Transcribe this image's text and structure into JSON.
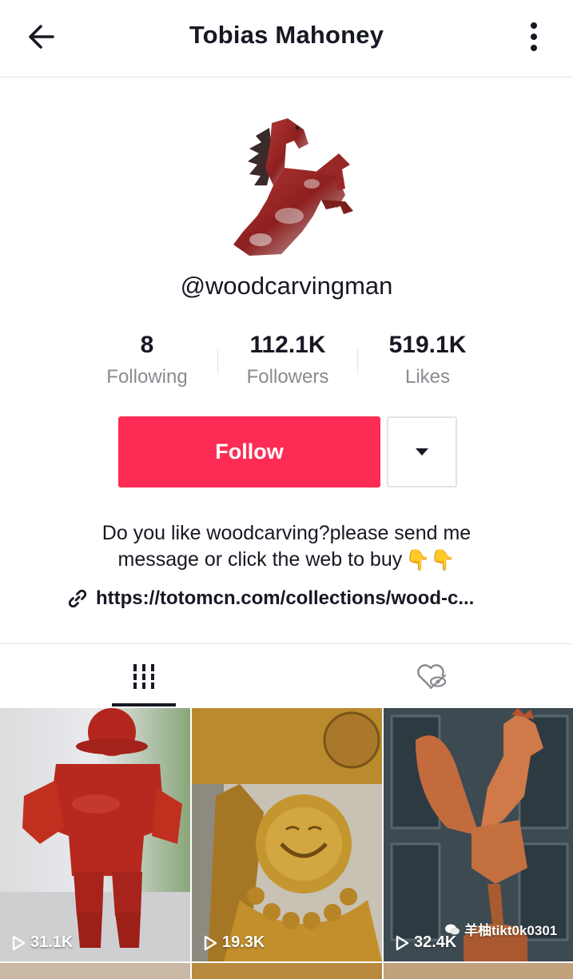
{
  "header": {
    "title": "Tobias Mahoney",
    "back_icon": "arrow-left-icon",
    "more_icon": "more-vertical-icon"
  },
  "profile": {
    "username": "@woodcarvingman",
    "avatar_icon": "carved-horse-avatar"
  },
  "stats": [
    {
      "value": "8",
      "label": "Following"
    },
    {
      "value": "112.1K",
      "label": "Followers"
    },
    {
      "value": "519.1K",
      "label": "Likes"
    }
  ],
  "actions": {
    "follow_label": "Follow",
    "dropdown_icon": "caret-down-icon"
  },
  "bio": {
    "line1": "Do you like woodcarving?please send me",
    "line2": "message or click the web to buy",
    "emoji": "👇👇",
    "link": "https://totomcn.com/collections/wood-c...",
    "link_icon": "link-icon"
  },
  "tabs": [
    {
      "icon": "videos-grid-icon",
      "active": true
    },
    {
      "icon": "liked-private-icon",
      "active": false
    }
  ],
  "videos": [
    {
      "views": "31.1K",
      "subject": "red carved pirate figure"
    },
    {
      "views": "19.3K",
      "subject": "laughing buddha carving"
    },
    {
      "views": "32.4K",
      "subject": "carved rooster"
    }
  ],
  "watermark": "羊柚tikt0k0301",
  "colors": {
    "accent": "#fe2c55",
    "text": "#161823",
    "muted": "#8a8b91",
    "border": "#e3e3e4"
  }
}
